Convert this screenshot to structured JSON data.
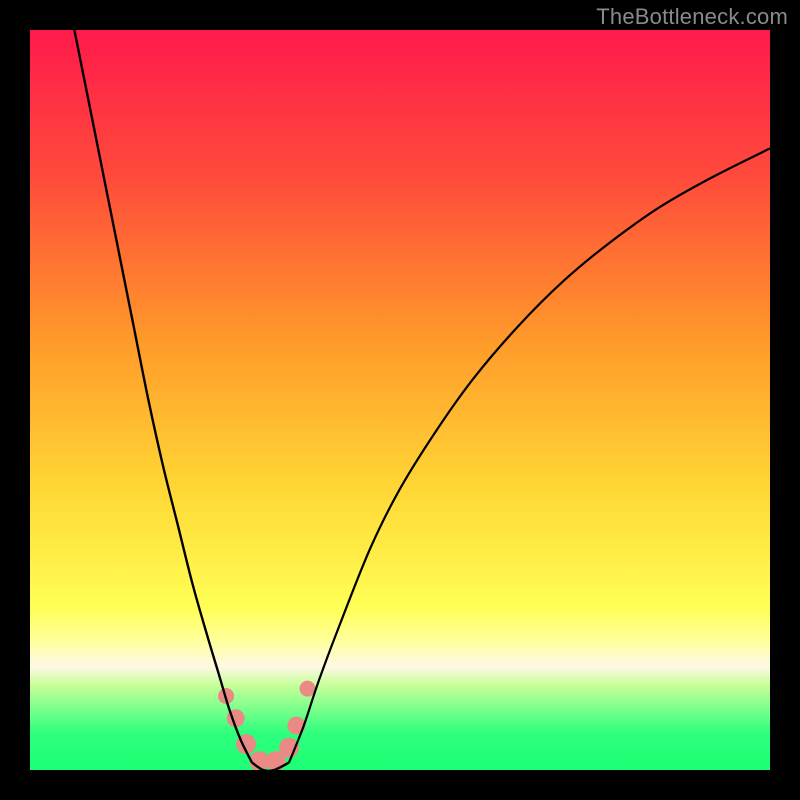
{
  "watermark": "TheBottleneck.com",
  "chart_data": {
    "type": "line",
    "title": "",
    "xlabel": "",
    "ylabel": "",
    "xlim": [
      0,
      100
    ],
    "ylim": [
      0,
      100
    ],
    "gradient_stops": [
      {
        "offset": 0,
        "color": "#ff1a4b"
      },
      {
        "offset": 0.2,
        "color": "#ff4b3b"
      },
      {
        "offset": 0.42,
        "color": "#ff9a2a"
      },
      {
        "offset": 0.62,
        "color": "#ffd735"
      },
      {
        "offset": 0.78,
        "color": "#ffff55"
      },
      {
        "offset": 0.83,
        "color": "#ffffa5"
      },
      {
        "offset": 0.86,
        "color": "#fff8e6"
      },
      {
        "offset": 0.885,
        "color": "#c8ff9a"
      },
      {
        "offset": 0.95,
        "color": "#2eff7d"
      },
      {
        "offset": 1.0,
        "color": "#1cff74"
      }
    ],
    "series": [
      {
        "name": "left-branch",
        "x": [
          6,
          8,
          10,
          12,
          14,
          16,
          18,
          20,
          22,
          24,
          25.5,
          27,
          28.5,
          30
        ],
        "y": [
          100,
          90,
          80,
          70,
          60,
          50,
          41,
          33,
          25,
          18,
          13,
          8,
          4,
          1
        ]
      },
      {
        "name": "right-branch",
        "x": [
          35,
          37,
          39,
          42,
          46,
          50,
          55,
          60,
          66,
          72,
          78,
          85,
          92,
          100
        ],
        "y": [
          1,
          6,
          12,
          20,
          30,
          38,
          46,
          53,
          60,
          66,
          71,
          76,
          80,
          84
        ]
      },
      {
        "name": "valley-floor",
        "x": [
          30,
          31.5,
          33,
          35
        ],
        "y": [
          1,
          0,
          0,
          1
        ]
      }
    ],
    "markers": {
      "name": "pink-dots",
      "color": "#e98b84",
      "points": [
        {
          "x": 26.5,
          "y": 10,
          "r": 8
        },
        {
          "x": 27.8,
          "y": 7,
          "r": 9
        },
        {
          "x": 29.2,
          "y": 3.5,
          "r": 10
        },
        {
          "x": 31.0,
          "y": 1.2,
          "r": 10
        },
        {
          "x": 33.2,
          "y": 1.2,
          "r": 10
        },
        {
          "x": 35.0,
          "y": 3.0,
          "r": 10
        },
        {
          "x": 36.0,
          "y": 6.0,
          "r": 9
        },
        {
          "x": 37.5,
          "y": 11,
          "r": 8
        }
      ]
    }
  }
}
